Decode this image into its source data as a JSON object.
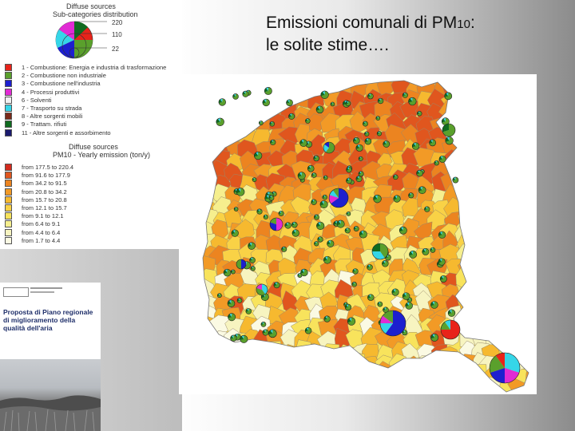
{
  "slide": {
    "title_line1": "Emissioni comunali di PM",
    "title_sub": "10",
    "title_colon": ":",
    "title_line2": "le solite stime…."
  },
  "legend": {
    "header1": "Diffuse sources",
    "header2": "Sub-categories distribution",
    "pie_scale": [
      "220",
      "110",
      "22"
    ],
    "categories": [
      {
        "label": "1 - Combustione: Energia e industria di trasformazione",
        "color": "#e8231a"
      },
      {
        "label": "2 - Combustione non industriale",
        "color": "#5aa02c"
      },
      {
        "label": "3 - Combustione nell'industria",
        "color": "#1d1fcf"
      },
      {
        "label": "4 - Processi produttivi",
        "color": "#e12bd4"
      },
      {
        "label": "6 - Solventi",
        "color": "#f2f2f2"
      },
      {
        "label": "7 - Trasporto su strada",
        "color": "#35d6e8"
      },
      {
        "label": "8 - Altre sorgenti mobili",
        "color": "#7a2a1a"
      },
      {
        "label": "9 - Trattam. rifiuti",
        "color": "#106b20"
      },
      {
        "label": "11 - Altre sorgenti e assorbimento",
        "color": "#1a1a6e"
      }
    ],
    "header3": "Diffuse sources",
    "header4": "PM10 - Yearly emission (ton/y)",
    "classes": [
      {
        "label": "from 177.5 to 220.4",
        "color": "#d42b1e"
      },
      {
        "label": "from 91.6 to 177.9",
        "color": "#e0561e"
      },
      {
        "label": "from 34.2 to 91.5",
        "color": "#ec8420"
      },
      {
        "label": "from 20.8 to 34.2",
        "color": "#f29a26"
      },
      {
        "label": "from 15.7 to 20.8",
        "color": "#f6b92f"
      },
      {
        "label": "from 12.1 to 15.7",
        "color": "#f9d246"
      },
      {
        "label": "from 9.1 to 12.1",
        "color": "#f8e35c"
      },
      {
        "label": "from 6.4 to 9.1",
        "color": "#f6ef8e"
      },
      {
        "label": "from 4.4 to 6.4",
        "color": "#f7f4c0"
      },
      {
        "label": "from 1.7 to 4.4",
        "color": "#fbfae3"
      }
    ]
  },
  "book": {
    "title": "Proposta di Piano regionale di miglioramento della qualità dell'aria"
  },
  "map": {
    "background": "#ffffff"
  }
}
